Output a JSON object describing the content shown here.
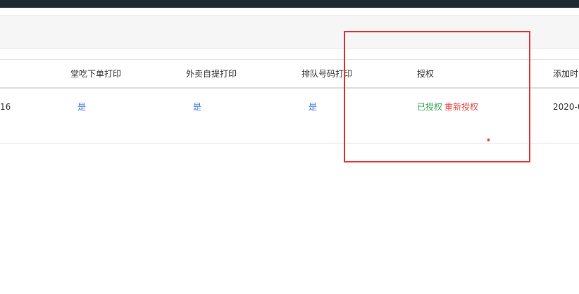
{
  "table": {
    "headers": [
      "堂吃下单打印",
      "外卖自提打印",
      "排队号码打印",
      "授权",
      "添加时"
    ],
    "row": {
      "partial_left": "16",
      "dine_in_print": "是",
      "takeout_print": "是",
      "queue_print": "是",
      "auth_status": "已授权",
      "reauth_link": "重新授权",
      "added_time": "2020-0"
    }
  },
  "colors": {
    "topbar": "#1f2932",
    "link_blue": "#3b7ad9",
    "authorized_green": "#3aa655",
    "reauth_red": "#e04848",
    "highlight_red": "#e53b3b"
  }
}
